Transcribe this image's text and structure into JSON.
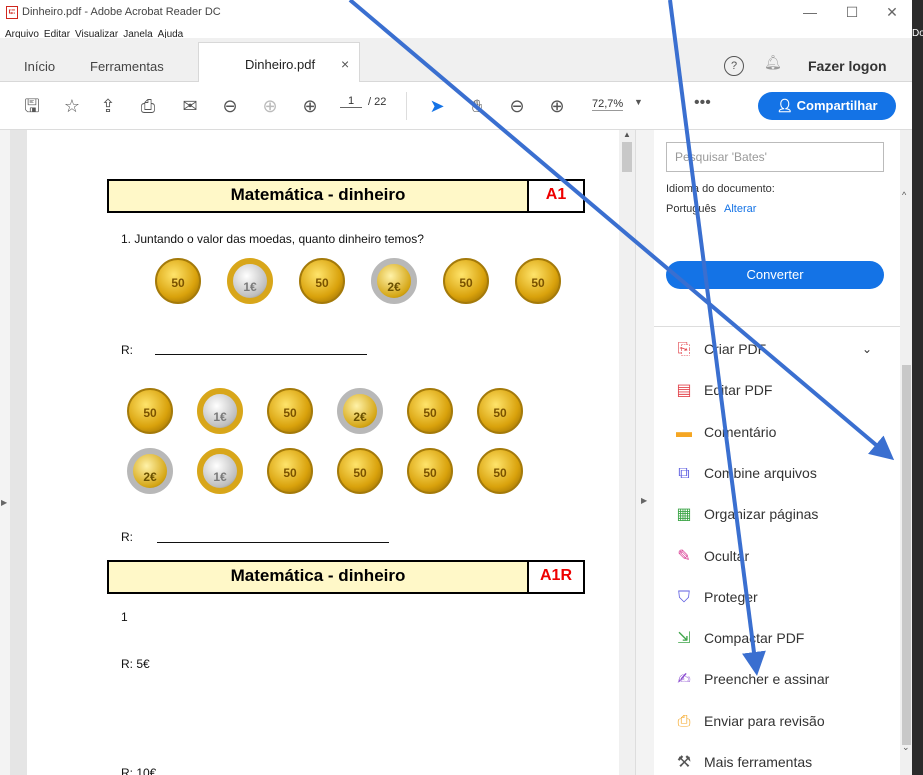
{
  "window": {
    "title": "Dinheiro.pdf - Adobe Acrobat Reader DC",
    "side_text": "Do"
  },
  "menu": [
    "Arquivo",
    "Editar",
    "Visualizar",
    "Janela",
    "Ajuda"
  ],
  "tabs": {
    "home": "Início",
    "tools": "Ferramentas",
    "doc": "Dinheiro.pdf",
    "close": "×",
    "login": "Fazer logon"
  },
  "toolbar": {
    "page_current": "1",
    "page_total": "/ 22",
    "zoom": "72,7%",
    "share": "Compartilhar"
  },
  "document": {
    "header1": {
      "title": "Matemática - dinheiro",
      "code": "A1"
    },
    "question1": "1. Juntando o valor das moedas, quanto dinheiro temos?",
    "r_label": "R:",
    "coins_row1": [
      "50",
      "1€",
      "50",
      "2€",
      "50",
      "50"
    ],
    "coins_row2": [
      "50",
      "1€",
      "50",
      "2€",
      "50",
      "50"
    ],
    "coins_row3": [
      "2€",
      "1€",
      "50",
      "50",
      "50",
      "50"
    ],
    "header2": {
      "title": "Matemática - dinheiro",
      "code": "A1R"
    },
    "answer_num": "1",
    "answer1": "R: 5€",
    "answer2": "R: 10€"
  },
  "right_pane": {
    "search_placeholder": "Pesquisar 'Bates'",
    "lang_label": "Idioma do documento:",
    "lang_value": "Português",
    "lang_change": "Alterar",
    "convert": "Converter",
    "tools": [
      {
        "label": "Criar PDF",
        "icon": "create-pdf-icon",
        "color": "#e34850"
      },
      {
        "label": "Editar PDF",
        "icon": "edit-pdf-icon",
        "color": "#e34850"
      },
      {
        "label": "Comentário",
        "icon": "comment-icon",
        "color": "#f5a623"
      },
      {
        "label": "Combine arquivos",
        "icon": "combine-files-icon",
        "color": "#5c5ce0"
      },
      {
        "label": "Organizar páginas",
        "icon": "organize-pages-icon",
        "color": "#3fa64a"
      },
      {
        "label": "Ocultar",
        "icon": "redact-icon",
        "color": "#d83790"
      },
      {
        "label": "Proteger",
        "icon": "protect-icon",
        "color": "#5c5ce0"
      },
      {
        "label": "Compactar PDF",
        "icon": "compress-pdf-icon",
        "color": "#3fa64a"
      },
      {
        "label": "Preencher e assinar",
        "icon": "fill-sign-icon",
        "color": "#8a4bd0"
      },
      {
        "label": "Enviar para revisão",
        "icon": "send-review-icon",
        "color": "#f5a623"
      },
      {
        "label": "Mais ferramentas",
        "icon": "more-tools-icon",
        "color": "#555555"
      }
    ]
  },
  "colors": {
    "accent": "#1473e6",
    "annotation_arrow": "#3a6fd0",
    "header_fill": "#fff8c8",
    "code_red": "#e00000"
  }
}
